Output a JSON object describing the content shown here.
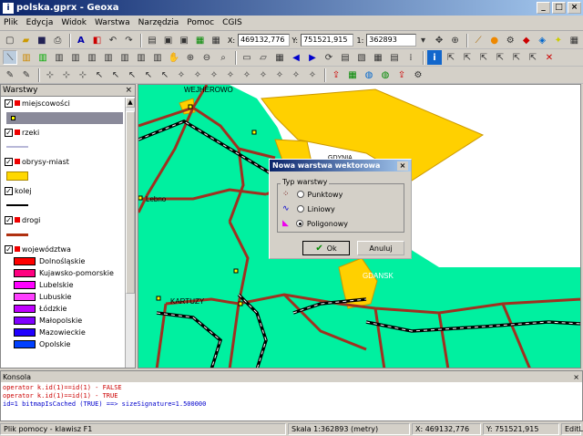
{
  "window": {
    "title": "polska.gprx - Geoxa",
    "min": "_",
    "max": "□",
    "close": "×"
  },
  "menu": [
    "Plik",
    "Edycja",
    "Widok",
    "Warstwa",
    "Narzędzia",
    "Pomoc",
    "CGIS"
  ],
  "toolbar": {
    "x_label": "X:",
    "x_value": "469132,776",
    "y_label": "Y:",
    "y_value": "751521,915",
    "scale_label": "1:",
    "scale_value": "362893"
  },
  "layers": {
    "title": "Warstwy",
    "close": "×",
    "items": [
      {
        "name": "miejscowości",
        "color": "#7f7f7f"
      },
      {
        "name": "rzeki",
        "color": "#b8b8d8"
      },
      {
        "name": "obrysy-miast",
        "color": "#ffd800"
      },
      {
        "name": "kolej",
        "color": "#000000"
      },
      {
        "name": "drogi",
        "color": "#b03010"
      },
      {
        "name": "województwa",
        "color": "#ff0000"
      }
    ],
    "regions": [
      {
        "name": "Dolnośląskie",
        "color": "#ff0000"
      },
      {
        "name": "Kujawsko-pomorskie",
        "color": "#ff0080"
      },
      {
        "name": "Lubelskie",
        "color": "#ff00ff"
      },
      {
        "name": "Lubuskie",
        "color": "#ff40ff"
      },
      {
        "name": "Łódzkie",
        "color": "#c000ff"
      },
      {
        "name": "Małopolskie",
        "color": "#8000ff"
      },
      {
        "name": "Mazowieckie",
        "color": "#2000ff"
      },
      {
        "name": "Opolskie",
        "color": "#0040ff"
      }
    ]
  },
  "map": {
    "labels": [
      "WEJHEROWO",
      "GDYNIA",
      "Lebno",
      "GDANSK",
      "KARTUZY"
    ],
    "land": "#00f0a0",
    "city": "#ffd000",
    "road": "#a03020"
  },
  "dialog": {
    "title": "Nowa warstwa wektorowa",
    "close": "×",
    "group": "Typ warstwy",
    "options": [
      "Punktowy",
      "Liniowy",
      "Poligonowy"
    ],
    "selected": 2,
    "ok": "Ok",
    "cancel": "Anuluj"
  },
  "console": {
    "title": "Konsola",
    "close": "×",
    "lines": [
      "operator k.id(1)==id(1) - FALSE",
      "operator k.id(1)==id(1) - TRUE",
      "  id=1 bitmapIsCached (TRUE) ==> sizeSignature=1.500000"
    ]
  },
  "status": {
    "help": "Plik pomocy - klawisz F1",
    "scale": "Skala 1:362893 (metry)",
    "x": "X: 469132,776",
    "y": "Y: 751521,915",
    "mode": "EditL"
  }
}
